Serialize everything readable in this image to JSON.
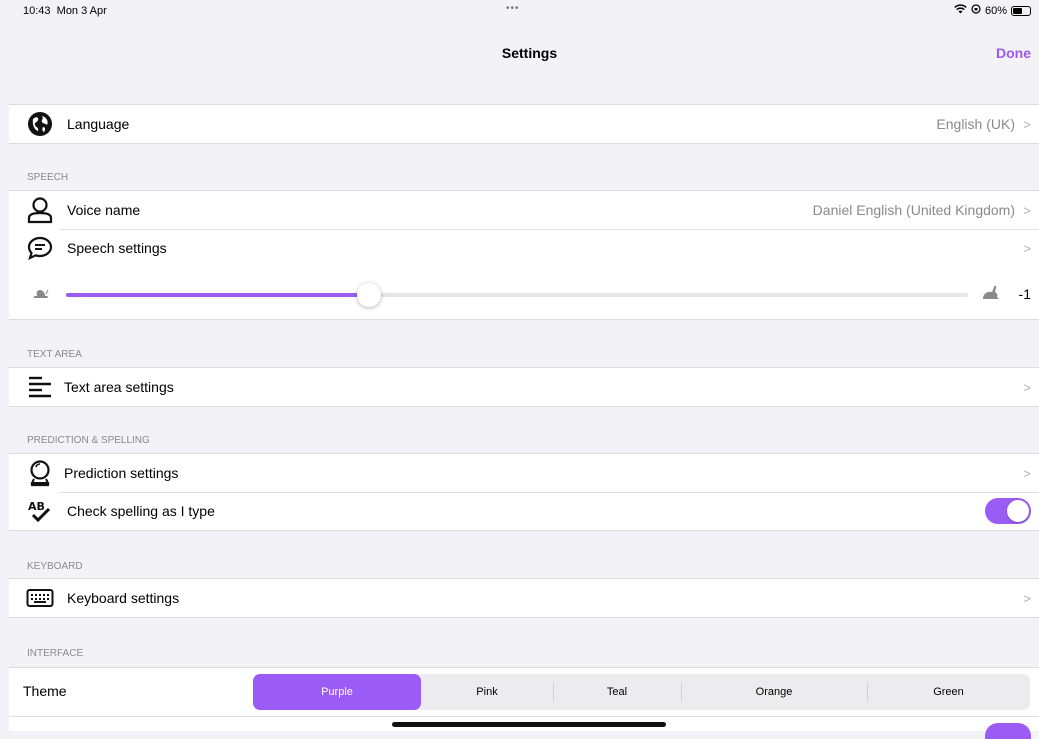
{
  "status_bar": {
    "time": "10:43",
    "date": "Mon 3 Apr",
    "dots": "•••",
    "battery": "60%",
    "battery_level": 0.6
  },
  "nav": {
    "title": "Settings",
    "done_label": "Done"
  },
  "language": {
    "label": "Language",
    "value": "English (UK)",
    "icon": "globe-icon"
  },
  "speech": {
    "header": "SPEECH",
    "voice": {
      "label": "Voice name",
      "value": "Daniel English (United Kingdom)",
      "icon": "person-icon"
    },
    "settings": {
      "label": "Speech settings",
      "icon": "speech-bubble-icon"
    },
    "rate": {
      "value_label": "-1",
      "fraction": 0.336,
      "slow_icon": "snail-icon",
      "fast_icon": "rabbit-icon"
    }
  },
  "text_area": {
    "header": "TEXT AREA",
    "settings": {
      "label": "Text area settings",
      "icon": "text-lines-icon"
    }
  },
  "prediction": {
    "header": "PREDICTION & SPELLING",
    "settings": {
      "label": "Prediction settings",
      "icon": "crystal-ball-icon"
    },
    "spelling": {
      "label": "Check spelling as I type",
      "icon": "spellcheck-icon",
      "enabled": true
    }
  },
  "keyboard": {
    "header": "KEYBOARD",
    "settings": {
      "label": "Keyboard settings",
      "icon": "keyboard-icon"
    }
  },
  "interface": {
    "header": "INTERFACE",
    "theme": {
      "label": "Theme",
      "options": [
        "Purple",
        "Pink",
        "Teal",
        "Orange",
        "Green"
      ],
      "selected": "Purple"
    }
  },
  "colors": {
    "accent": "#9b5cf5",
    "background": "#f2f2f7"
  }
}
